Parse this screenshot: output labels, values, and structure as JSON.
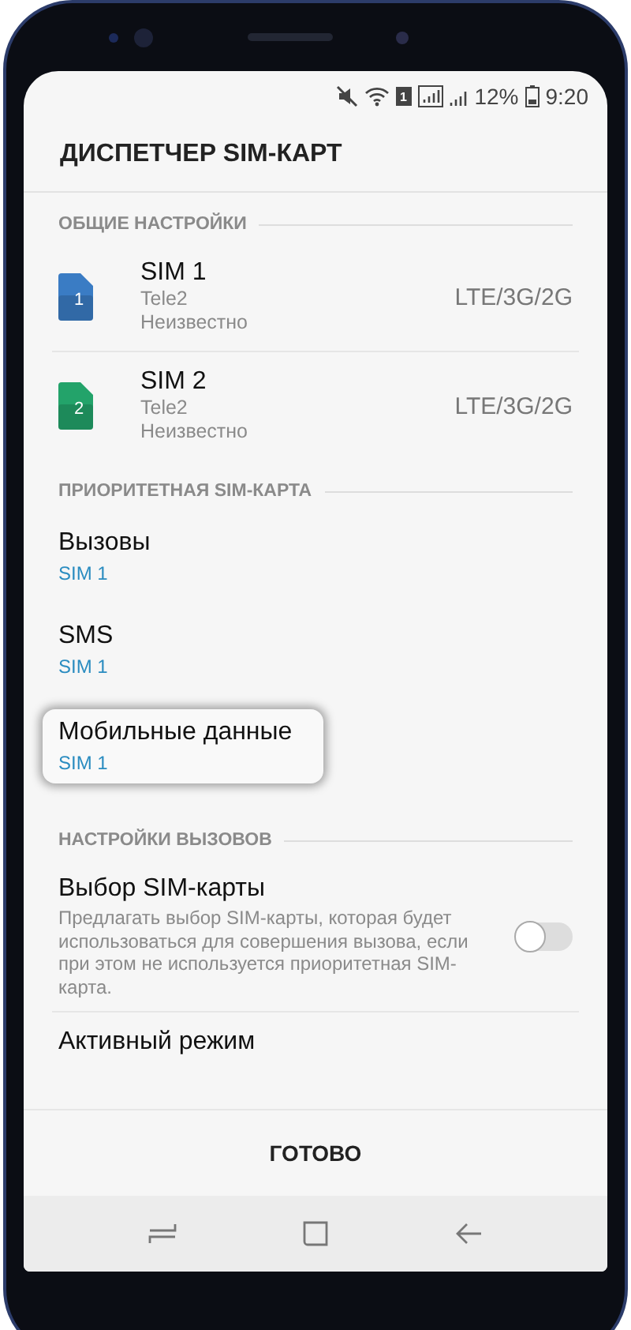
{
  "status_bar": {
    "sim_badge": "1",
    "battery": "12%",
    "time": "9:20"
  },
  "title": "ДИСПЕТЧЕР SIM-КАРТ",
  "sections": [
    {
      "title": "ОБЩИЕ НАСТРОЙКИ",
      "items": [
        {
          "kind": "sim",
          "name": "SIM 1",
          "number": "1",
          "color": "#3a7cc4",
          "operator": "Tele2",
          "status": "Неизвестно",
          "network": "LTE/3G/2G"
        },
        {
          "kind": "sim",
          "name": "SIM 2",
          "number": "2",
          "color": "#23a36a",
          "operator": "Tele2",
          "status": "Неизвестно",
          "network": "LTE/3G/2G"
        }
      ]
    },
    {
      "title": "ПРИОРИТЕТНАЯ SIM-КАРТА",
      "items": [
        {
          "kind": "pref",
          "name": "Вызовы",
          "value": "SIM 1",
          "highlighted": false
        },
        {
          "kind": "pref",
          "name": "SMS",
          "value": "SIM 1",
          "highlighted": false
        },
        {
          "kind": "pref",
          "name": "Мобильные данные",
          "value": "SIM 1",
          "highlighted": true
        }
      ]
    },
    {
      "title": "НАСТРОЙКИ ВЫЗОВОВ",
      "items": [
        {
          "kind": "switch",
          "name": "Выбор SIM-карты",
          "description": "Предлагать выбор SIM-карты, которая будет использоваться для совершения вызова, если при этом не используется приоритетная SIM-карта.",
          "on": false
        },
        {
          "kind": "plain",
          "name": "Активный режим"
        }
      ]
    }
  ],
  "done_button": "ГОТОВО"
}
